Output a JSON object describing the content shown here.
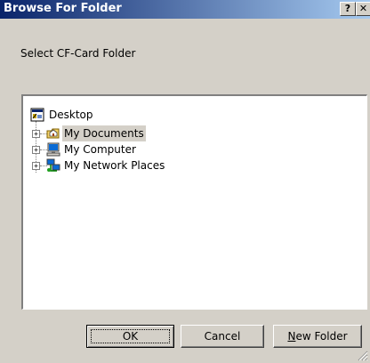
{
  "window": {
    "title": "Browse For Folder",
    "help_label": "?",
    "close_label": "✕"
  },
  "prompt": "Select CF-Card Folder",
  "tree": {
    "root": {
      "label": "Desktop",
      "icon": "desktop-icon"
    },
    "children": [
      {
        "label": "My Documents",
        "icon": "my-documents-folder-icon",
        "selected": true
      },
      {
        "label": "My Computer",
        "icon": "my-computer-icon",
        "selected": false
      },
      {
        "label": "My Network Places",
        "icon": "network-places-icon",
        "selected": false
      }
    ]
  },
  "buttons": {
    "ok": "OK",
    "cancel": "Cancel",
    "new_folder_accel": "N",
    "new_folder_rest": "ew Folder"
  },
  "colors": {
    "face": "#d4d0c8",
    "title_start": "#0a246a",
    "title_end": "#a6caf0"
  }
}
